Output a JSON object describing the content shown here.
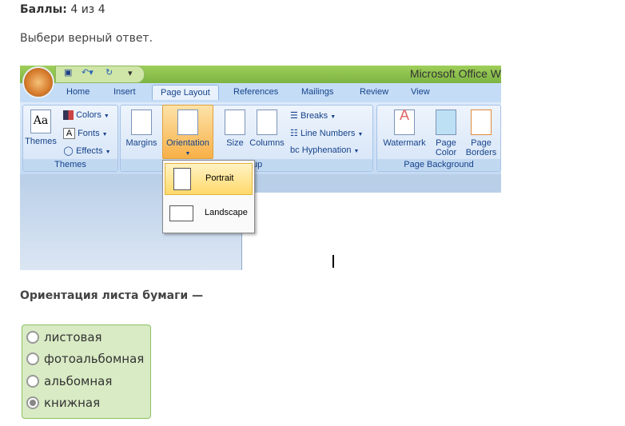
{
  "score": {
    "label": "Баллы:",
    "value": "4 из 4"
  },
  "prompt": "Выбери верный ответ.",
  "screenshot": {
    "app_title": "Microsoft Office W",
    "tabs": [
      "Home",
      "Insert",
      "Page Layout",
      "References",
      "Mailings",
      "Review",
      "View"
    ],
    "active_tab": "Page Layout",
    "themes_group": {
      "label": "Themes",
      "themes": "Themes",
      "colors": "Colors",
      "fonts": "Fonts",
      "effects": "Effects"
    },
    "page_setup": {
      "label": "up",
      "margins": "Margins",
      "orientation": "Orientation",
      "size": "Size",
      "columns": "Columns",
      "breaks": "Breaks",
      "line_numbers": "Line Numbers",
      "hyphenation": "Hyphenation"
    },
    "page_background": {
      "label": "Page Background",
      "watermark": "Watermark",
      "page_color_1": "Page",
      "page_color_2": "Color",
      "page_borders_1": "Page",
      "page_borders_2": "Borders"
    },
    "orientation_menu": [
      "Portrait",
      "Landscape"
    ],
    "selected_orientation": "Portrait"
  },
  "question": "Ориентация листа бумаги —",
  "options": [
    {
      "label": "листовая",
      "selected": false
    },
    {
      "label": "фотоальбомная",
      "selected": false
    },
    {
      "label": "альбомная",
      "selected": false
    },
    {
      "label": "книжная",
      "selected": true
    }
  ]
}
